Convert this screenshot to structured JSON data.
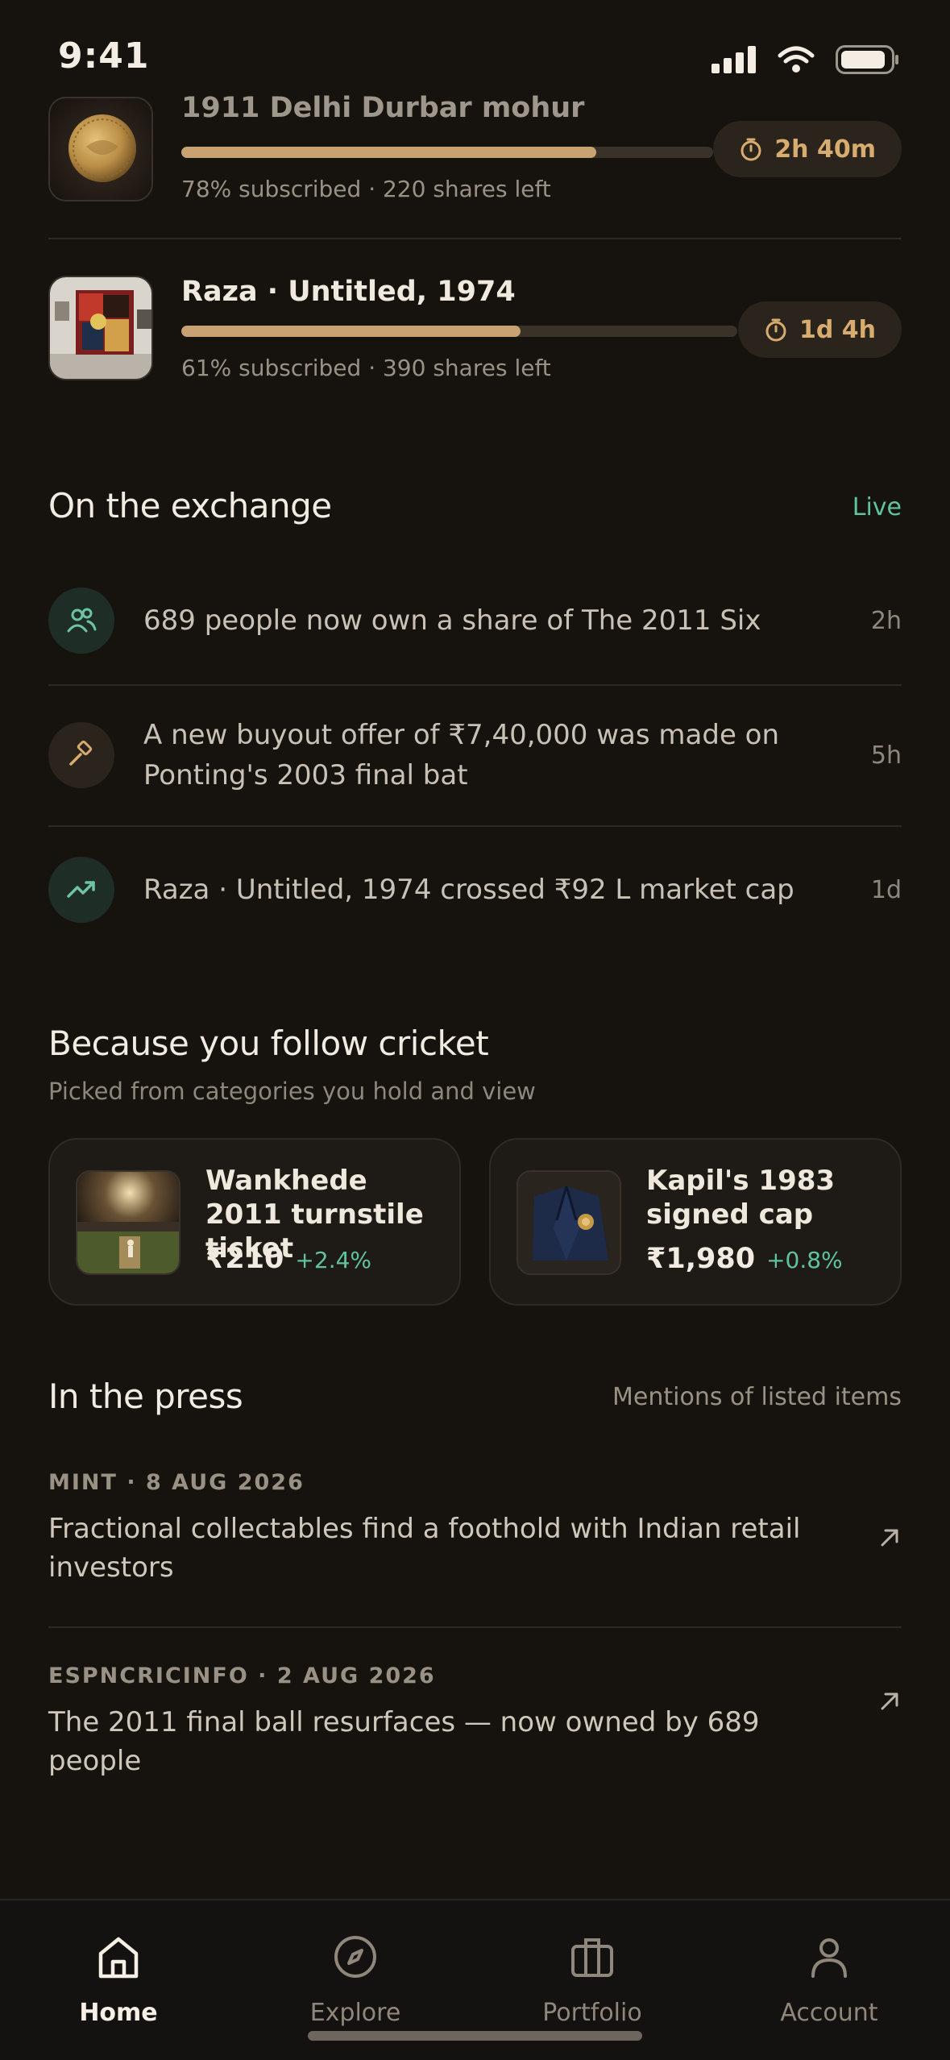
{
  "status_bar": {
    "time": "9:41"
  },
  "offerings": [
    {
      "title": "1911 Delhi Durbar mohur",
      "progress": 0.78,
      "meta": "78% subscribed · 220 shares left",
      "timer": "2h 40m"
    },
    {
      "title": "Raza · Untitled, 1974",
      "progress": 0.61,
      "meta": "61% subscribed · 390 shares left",
      "timer": "1d 4h"
    }
  ],
  "exchange": {
    "title": "On the exchange",
    "status": "Live",
    "items": [
      {
        "icon": "people-icon",
        "text": "689 people now own a share of The 2011 Six",
        "time": "2h"
      },
      {
        "icon": "gavel-icon",
        "text": "A new buyout offer of ₹7,40,000 was made on Ponting's 2003 final bat",
        "time": "5h"
      },
      {
        "icon": "trending-up-icon",
        "text": "Raza · Untitled, 1974 crossed ₹92 L market cap",
        "time": "1d"
      }
    ]
  },
  "recommend": {
    "title": "Because you follow cricket",
    "subtitle": "Picked from categories you hold and view",
    "cards": [
      {
        "title": "Wankhede 2011 turnstile ticket",
        "price": "₹210",
        "change": "+2.4%"
      },
      {
        "title": "Kapil's 1983 signed cap",
        "price": "₹1,980",
        "change": "+0.8%"
      }
    ]
  },
  "press": {
    "title": "In the press",
    "aside": "Mentions of listed items",
    "items": [
      {
        "source": "MINT · 8 AUG 2026",
        "headline": "Fractional collectables find a foothold with Indian retail investors"
      },
      {
        "source": "ESPNCRICINFO · 2 AUG 2026",
        "headline": "The 2011 final ball resurfaces — now owned by 689 people"
      }
    ]
  },
  "tabs": [
    {
      "label": "Home",
      "icon": "home-icon",
      "active": true
    },
    {
      "label": "Explore",
      "icon": "compass-icon",
      "active": false
    },
    {
      "label": "Portfolio",
      "icon": "briefcase-icon",
      "active": false
    },
    {
      "label": "Account",
      "icon": "person-icon",
      "active": false
    }
  ],
  "colors": {
    "accent_gold": "#c8a272",
    "positive": "#5fc3a0",
    "background": "#16130f"
  }
}
